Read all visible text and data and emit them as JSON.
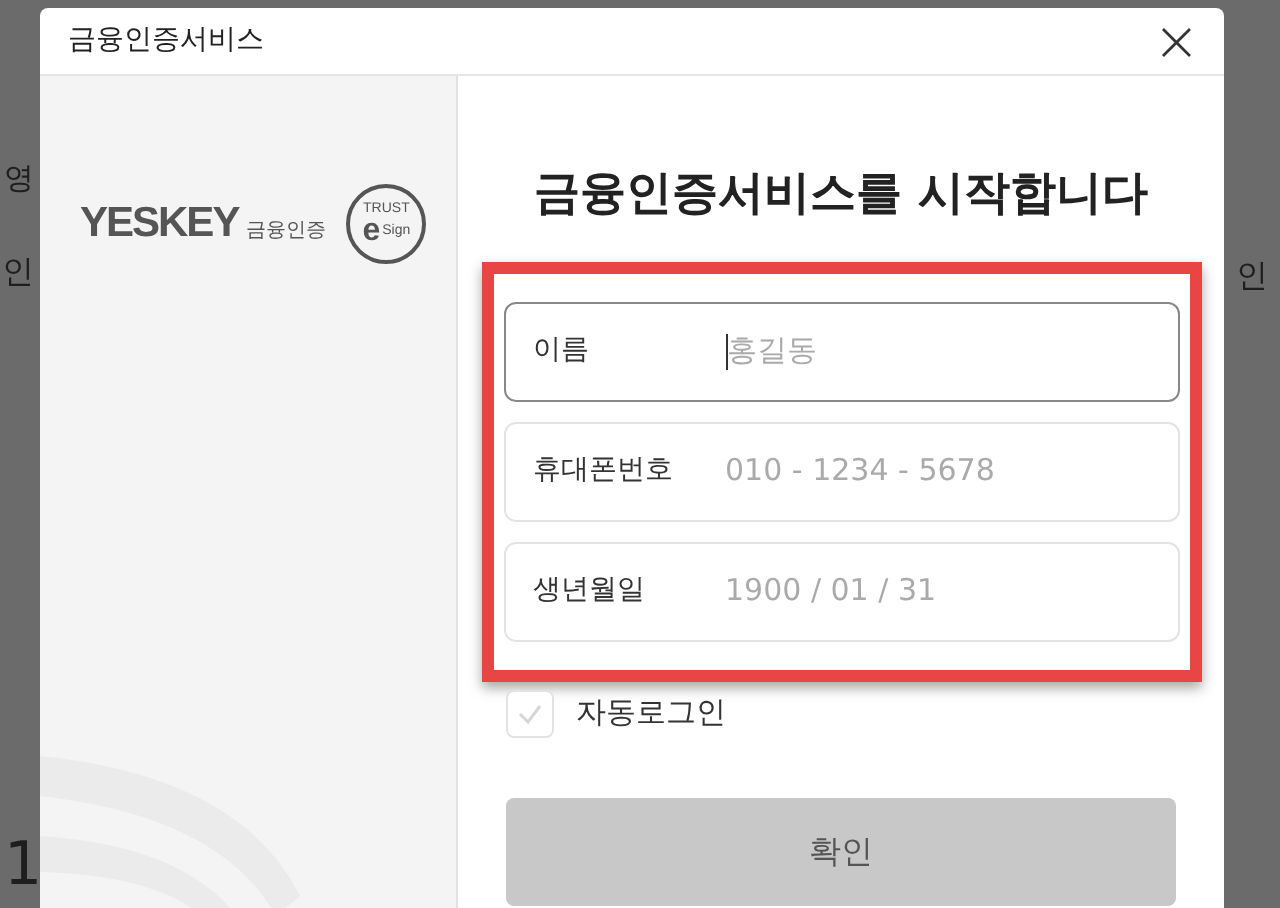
{
  "background_fragments": [
    {
      "text": "영",
      "kind": "left_top"
    },
    {
      "text": "인",
      "kind": "left_mid"
    },
    {
      "text": "인",
      "kind": "right_mid"
    },
    {
      "text": "1",
      "kind": "left_bottom"
    }
  ],
  "dialog": {
    "title": "금융인증서비스",
    "close": "×"
  },
  "logo": {
    "wordmark": "YESKEY",
    "subtitle": "금융인증",
    "badge_top": "TRUST",
    "badge_letter": "e",
    "badge_bottom": "Sign"
  },
  "heading": "금융인증서비스를 시작합니다",
  "fields": [
    {
      "label": "이름",
      "placeholder": "홍길동",
      "focused": true
    },
    {
      "label": "휴대폰번호",
      "placeholder": "010 - 1234 - 5678",
      "focused": false
    },
    {
      "label": "생년월일",
      "placeholder": "1900 / 01 / 31",
      "focused": false
    }
  ],
  "auto_login": {
    "label": "자동로그인",
    "checked": false
  },
  "confirm_button": {
    "label": "확인",
    "disabled": true
  }
}
